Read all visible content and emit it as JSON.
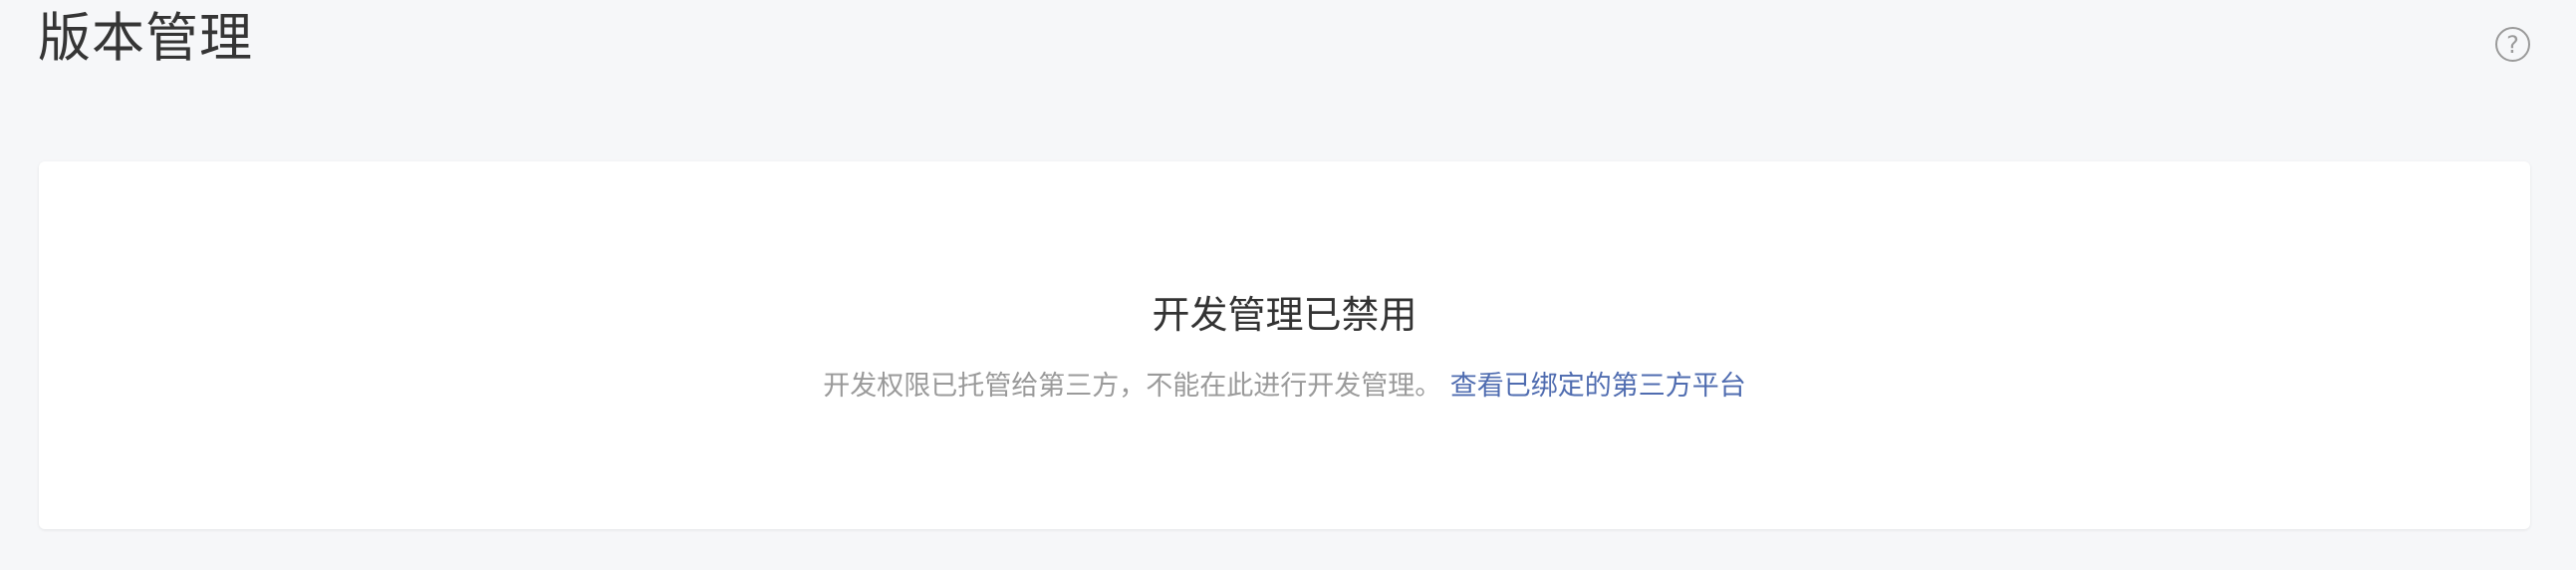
{
  "header": {
    "title": "版本管理",
    "help_icon_glyph": "?",
    "help_icon": "question-circle-icon"
  },
  "notice": {
    "title": "开发管理已禁用",
    "description": "开发权限已托管给第三方，不能在此进行开发管理。",
    "link_text": "查看已绑定的第三方平台"
  },
  "colors": {
    "background": "#f6f7f9",
    "card": "#ffffff",
    "title_text": "#353535",
    "muted_text": "#9a9a9a",
    "link": "#4f6cb0"
  }
}
